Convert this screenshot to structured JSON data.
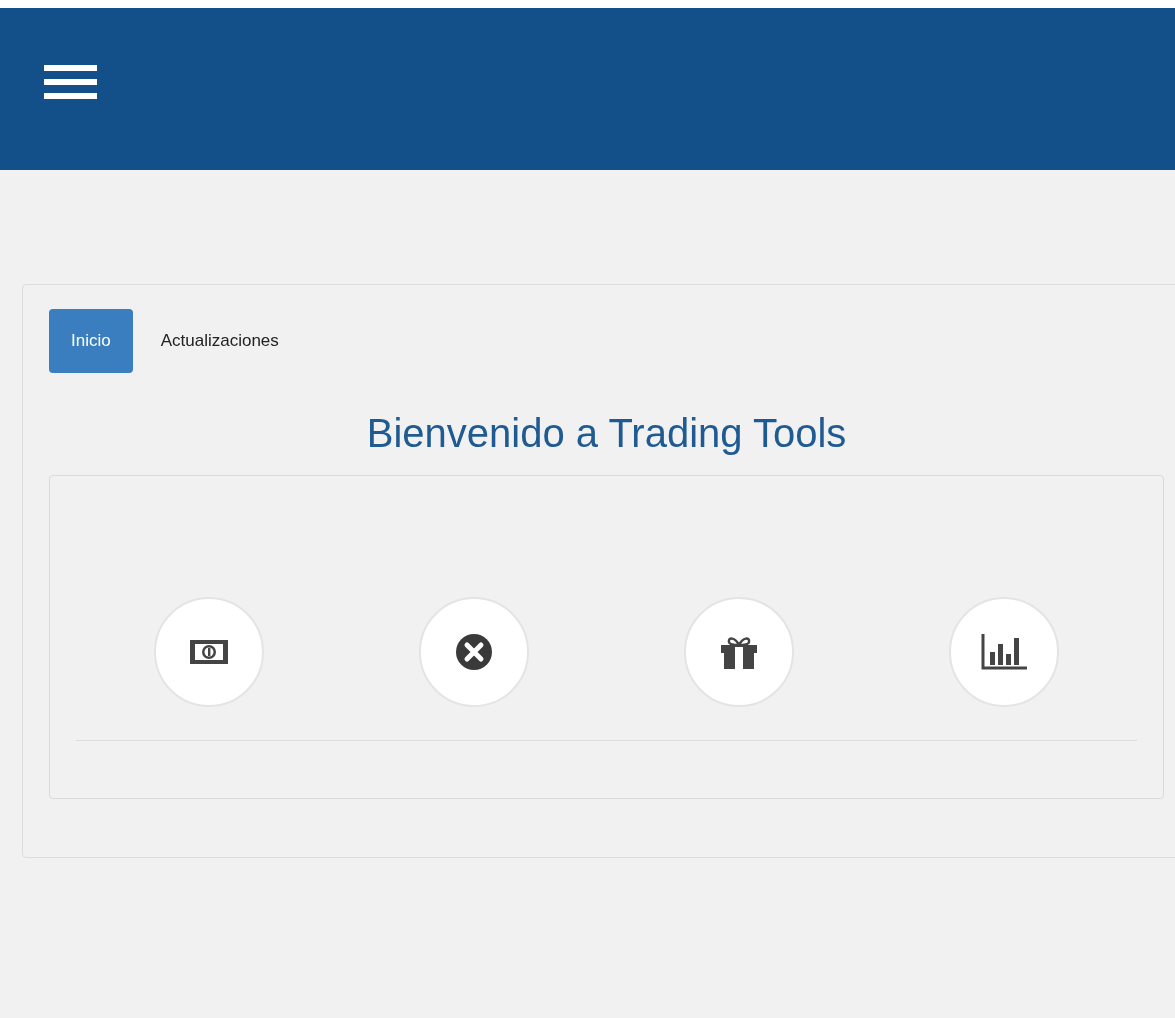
{
  "tabs": [
    {
      "label": "Inicio",
      "selected": true
    },
    {
      "label": "Actualizaciones",
      "selected": false
    }
  ],
  "title": "Bienvenido a Trading Tools",
  "tools": [
    {
      "kind": "money"
    },
    {
      "kind": "close"
    },
    {
      "kind": "gift"
    },
    {
      "kind": "chart"
    }
  ]
}
